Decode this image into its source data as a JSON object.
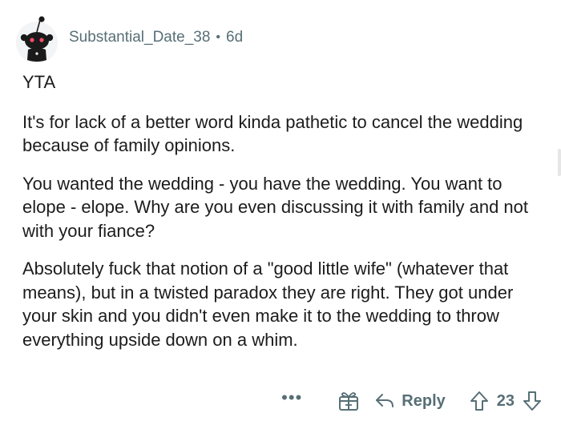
{
  "comment": {
    "author": "Substantial_Date_38",
    "separator": "•",
    "age": "6d",
    "paragraphs": [
      "YTA",
      "It's for lack of a better word kinda pathetic to cancel the wedding because of family opinions.",
      "You wanted the wedding - you have the wedding. You want to elope - elope. Why are you even discussing it with family and not with your fiance?",
      "Absolutely fuck that notion of a \"good little wife\" (whatever that means), but in a twisted paradox they are right. They got under your skin and you didn't even make it to the wedding to throw everything upside down on a whim."
    ]
  },
  "actions": {
    "more_label": "•••",
    "reply_label": "Reply",
    "vote_count": "23"
  },
  "icons": {
    "avatar": "snoo-avatar-icon",
    "more": "more-options-icon",
    "award": "award-icon",
    "reply": "reply-arrow-icon",
    "upvote": "upvote-arrow-icon",
    "downvote": "downvote-arrow-icon"
  },
  "colors": {
    "meta_text": "#576f76",
    "body_text": "#1c1c1c",
    "avatar_bg": "#f2f4f5",
    "snoo_dark": "#1a1a1b"
  }
}
